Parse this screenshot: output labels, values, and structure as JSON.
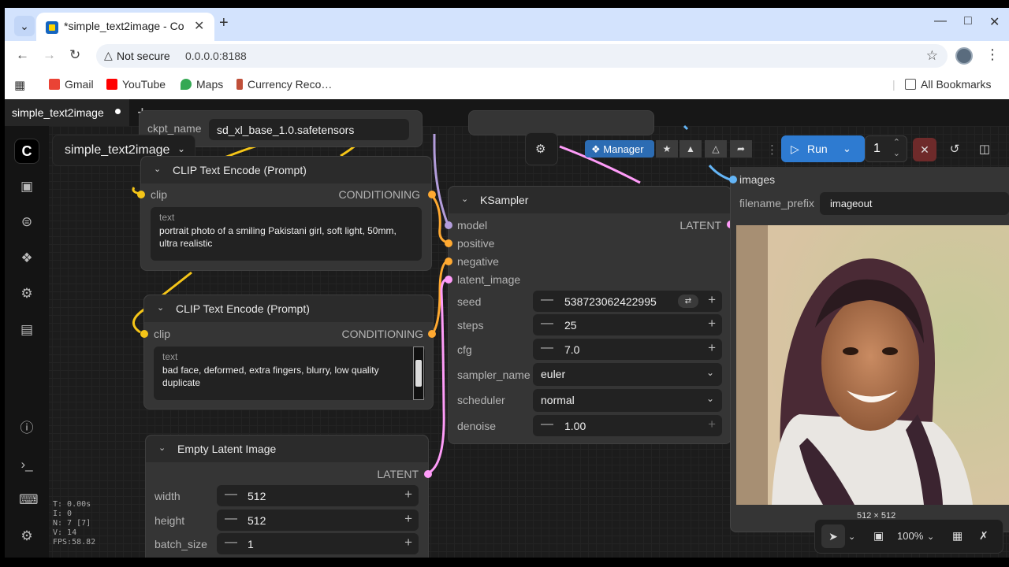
{
  "browser": {
    "tab_title": "*simple_text2image - Co",
    "address_warning": "Not secure",
    "url": "0.0.0.0:8188",
    "bookmarks": [
      "Gmail",
      "YouTube",
      "Maps",
      "Currency Reco…"
    ],
    "all_bookmarks": "All Bookmarks"
  },
  "app": {
    "workflow_tab": "simple_text2image",
    "workflow_menu": "simple_text2image",
    "toolbar": {
      "manager": "Manager",
      "run": "Run",
      "queue_count": "1"
    }
  },
  "nodes": {
    "partial_top": {
      "label": "ckpt_name",
      "value": "sd_xl_base_1.0.safetensors"
    },
    "clip_pos": {
      "title": "CLIP Text Encode (Prompt)",
      "input": "clip",
      "output": "CONDITIONING",
      "text_label": "text",
      "text": "portrait photo of a smiling Pakistani girl, soft light, 50mm, ultra realistic"
    },
    "clip_neg": {
      "title": "CLIP Text Encode (Prompt)",
      "input": "clip",
      "output": "CONDITIONING",
      "text_label": "text",
      "text": "bad face, deformed, extra fingers, blurry, low quality duplicate"
    },
    "latent": {
      "title": "Empty Latent Image",
      "output": "LATENT",
      "width_label": "width",
      "width": "512",
      "height_label": "height",
      "height": "512",
      "batch_label": "batch_size",
      "batch": "1"
    },
    "ksampler": {
      "title": "KSampler",
      "inputs": [
        "model",
        "positive",
        "negative",
        "latent_image"
      ],
      "output": "LATENT",
      "seed_label": "seed",
      "seed": "538723062422995",
      "steps_label": "steps",
      "steps": "25",
      "cfg_label": "cfg",
      "cfg": "7.0",
      "sampler_label": "sampler_name",
      "sampler": "euler",
      "scheduler_label": "scheduler",
      "scheduler": "normal",
      "denoise_label": "denoise",
      "denoise": "1.00"
    },
    "save": {
      "input": "images",
      "prefix_label": "filename_prefix",
      "prefix": "imageout",
      "dims": "512 × 512"
    }
  },
  "canvas_controls": {
    "zoom": "100%"
  },
  "stats": [
    "T: 0.00s",
    "I: 0",
    "N: 7 [7]",
    "V: 14",
    "FPS:58.82"
  ],
  "colors": {
    "clip": "#f5c518",
    "conditioning": "#ffa931",
    "latent": "#ff9cf9",
    "model": "#b39ddb",
    "image": "#64b5f6",
    "run": "#2e7bd1"
  }
}
